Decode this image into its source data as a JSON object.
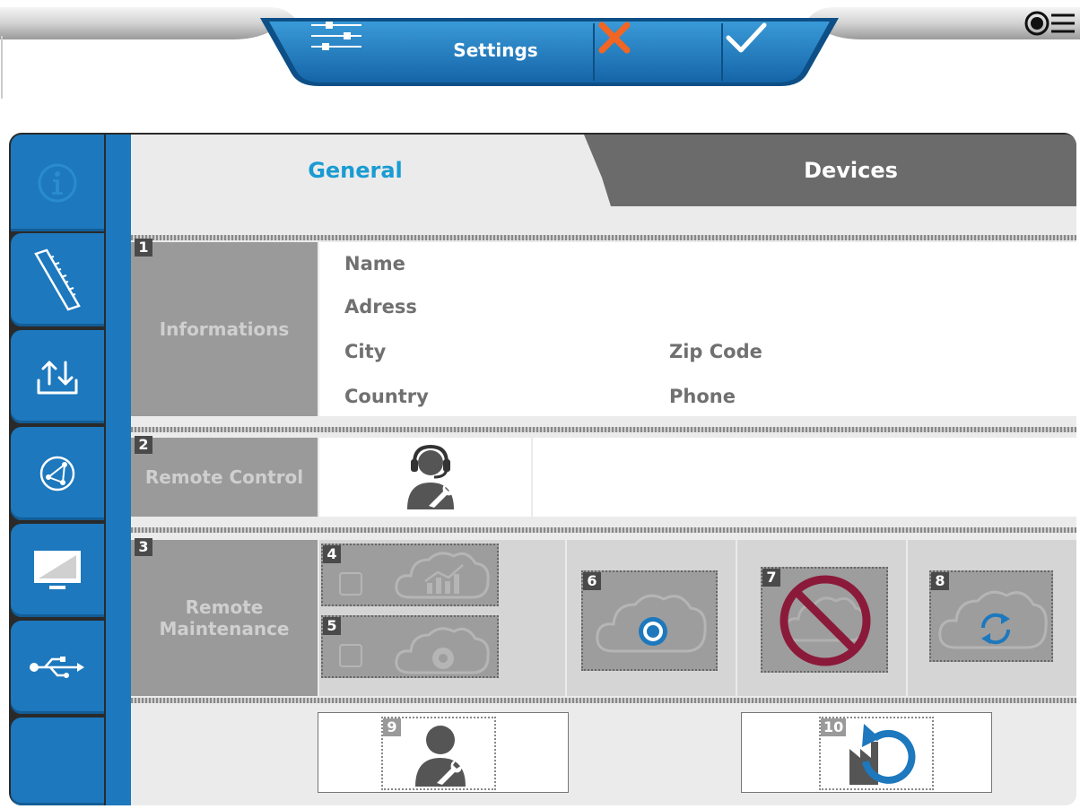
{
  "header": {
    "title": "Settings",
    "cancel_icon": "close-icon",
    "confirm_icon": "check-icon",
    "filter_icon": "sliders-icon",
    "menu_icon": "menu-icon"
  },
  "sidebar": {
    "items": [
      {
        "icon": "info-icon"
      },
      {
        "icon": "ruler-icon"
      },
      {
        "icon": "upload-download-icon"
      },
      {
        "icon": "network-icon"
      },
      {
        "icon": "monitor-icon"
      },
      {
        "icon": "usb-icon"
      },
      {
        "icon": "empty"
      }
    ]
  },
  "tabs": [
    {
      "label": "General",
      "active": true
    },
    {
      "label": "Devices",
      "active": false
    }
  ],
  "sections": {
    "info": {
      "number": "1",
      "label": "Informations",
      "fields": {
        "name": "Name",
        "address": "Adress",
        "city": "City",
        "zip": "Zip Code",
        "country": "Country",
        "phone": "Phone"
      }
    },
    "remote_control": {
      "number": "2",
      "label": "Remote Control"
    },
    "remote_maintenance": {
      "number": "3",
      "label_line1": "Remote",
      "label_line2": "Maintenance",
      "opt4": "4",
      "opt5": "5",
      "btn6": "6",
      "btn7": "7",
      "btn8": "8"
    },
    "bottom": {
      "btn9": "9",
      "btn10": "10"
    }
  },
  "colors": {
    "accent": "#1d78bd",
    "tab_active_text": "#1a9bd2",
    "cancel": "#f26522",
    "deny": "#8b1a3a"
  }
}
